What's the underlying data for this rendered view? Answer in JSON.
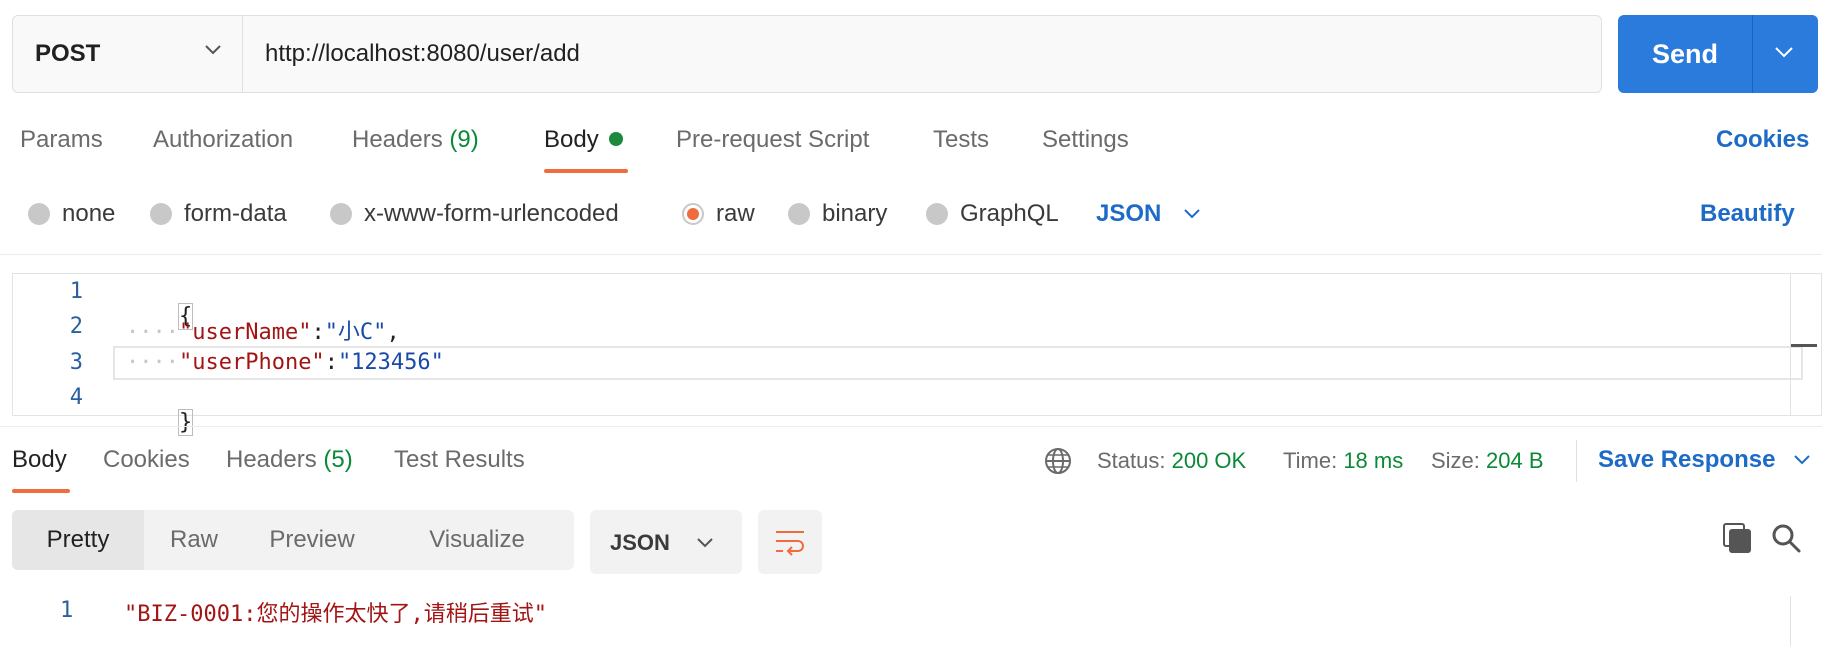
{
  "request": {
    "method": "POST",
    "url": "http://localhost:8080/user/add",
    "send_label": "Send"
  },
  "request_tabs": {
    "params": "Params",
    "authorization": "Authorization",
    "headers": "Headers",
    "headers_count": "(9)",
    "body": "Body",
    "pre_request": "Pre-request Script",
    "tests": "Tests",
    "settings": "Settings",
    "cookies": "Cookies"
  },
  "body_modes": {
    "none": "none",
    "form_data": "form-data",
    "urlencoded": "x-www-form-urlencoded",
    "raw": "raw",
    "binary": "binary",
    "graphql": "GraphQL",
    "selected": "raw",
    "language": "JSON",
    "beautify": "Beautify"
  },
  "editor": {
    "line_numbers": [
      "1",
      "2",
      "3",
      "4"
    ],
    "open_brace": "{",
    "close_brace": "}",
    "indent": "····",
    "key1": "\"userName\"",
    "value1": "\"小C\"",
    "key2": "\"userPhone\"",
    "value2": "\"123456\"",
    "colon": ":",
    "comma": ","
  },
  "response": {
    "tabs": {
      "body": "Body",
      "cookies": "Cookies",
      "headers": "Headers",
      "headers_count": "(5)",
      "test_results": "Test Results"
    },
    "status_label": "Status:",
    "status_value": "200 OK",
    "time_label": "Time:",
    "time_value": "18 ms",
    "size_label": "Size:",
    "size_value": "204 B",
    "save_response": "Save Response",
    "views": {
      "pretty": "Pretty",
      "raw": "Raw",
      "preview": "Preview",
      "visualize": "Visualize"
    },
    "format": "JSON",
    "line_number": "1",
    "body_text": "\"BIZ-0001:您的操作太快了,请稍后重试\""
  },
  "colors": {
    "accent_orange": "#ef6c3e",
    "send_blue": "#2b7bdc",
    "link_blue": "#1e6bc7",
    "success_green": "#0a8a36"
  }
}
